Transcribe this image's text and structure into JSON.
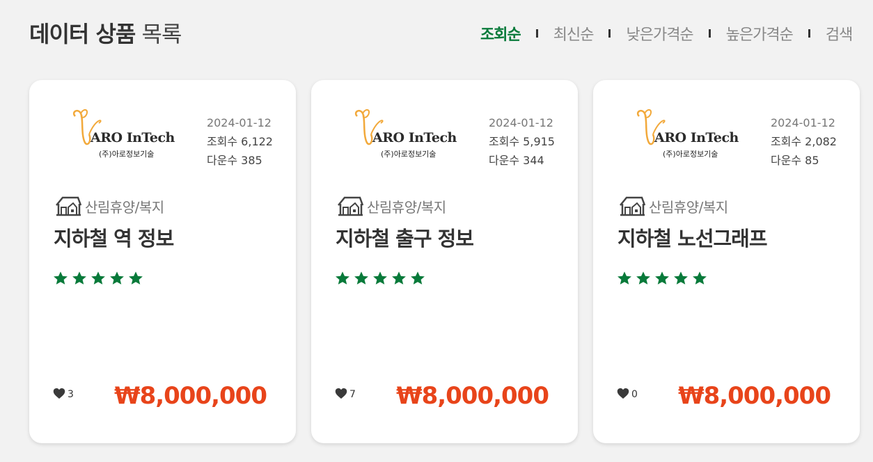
{
  "header": {
    "title_bold": "데이터 상품",
    "title_light": " 목록",
    "sort_tabs": [
      "조회순",
      "최신순",
      "낮은가격순",
      "높은가격순",
      "검색"
    ],
    "active_tab_index": 0
  },
  "colors": {
    "accent_green": "#087a3a",
    "price_orange": "#e8441a",
    "logo_orange": "#f2a93b"
  },
  "cards": [
    {
      "logo": {
        "name": "ARO InTech",
        "sub": "(주)아로정보기술"
      },
      "date": "2024-01-12",
      "views": "조회수 6,122",
      "downloads": "다운수 385",
      "category": "산림휴양/복지",
      "title": "지하철 역 정보",
      "rating": 5,
      "likes": "3",
      "price": "₩8,000,000"
    },
    {
      "logo": {
        "name": "ARO InTech",
        "sub": "(주)아로정보기술"
      },
      "date": "2024-01-12",
      "views": "조회수 5,915",
      "downloads": "다운수 344",
      "category": "산림휴양/복지",
      "title": "지하철 출구 정보",
      "rating": 5,
      "likes": "7",
      "price": "₩8,000,000"
    },
    {
      "logo": {
        "name": "ARO InTech",
        "sub": "(주)아로정보기술"
      },
      "date": "2024-01-12",
      "views": "조회수 2,082",
      "downloads": "다운수 85",
      "category": "산림휴양/복지",
      "title": "지하철 노선그래프",
      "rating": 5,
      "likes": "0",
      "price": "₩8,000,000"
    }
  ]
}
